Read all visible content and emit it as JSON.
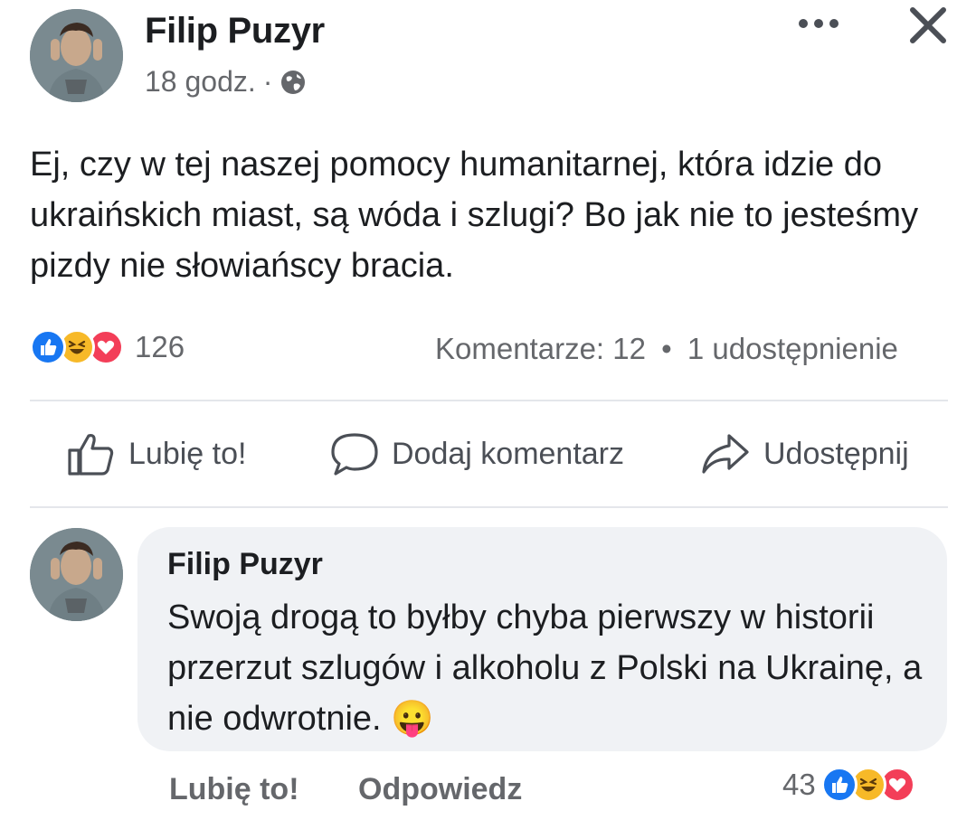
{
  "post": {
    "author": "Filip Puzyr",
    "time": "18 godz.",
    "separator": "·",
    "audience_icon": "globe-icon",
    "more_icon": "more-options-icon",
    "close_icon": "close-icon",
    "text": "Ej, czy w tej naszej pomocy humanitarnej, która idzie do ukraińskich miast, są wóda i szlugi? Bo jak nie to jesteśmy pizdy nie słowiańscy bracia."
  },
  "stats": {
    "reactions": [
      "like-reaction-icon",
      "haha-reaction-icon",
      "love-reaction-icon"
    ],
    "reaction_count": "126",
    "comments": "Komentarze: 12",
    "dot": "•",
    "shares": "1 udostępnienie"
  },
  "actions": {
    "like": "Lubię to!",
    "comment": "Dodaj komentarz",
    "share": "Udostępnij"
  },
  "comment": {
    "author": "Filip Puzyr",
    "text": "Swoją drogą to byłby chyba pierwszy w historii przerzut szlugów i alkoholu z Polski na Ukrainę, a nie odwrotnie.",
    "emoji": "😛",
    "like": "Lubię to!",
    "reply": "Odpowiedz",
    "reaction_count": "43",
    "reactions": [
      "like-reaction-icon",
      "haha-reaction-icon",
      "love-reaction-icon"
    ]
  },
  "colors": {
    "like_blue": "#1877f2",
    "haha_yellow": "#f7b928",
    "love_red": "#f33e58",
    "muted_text": "#65676b",
    "bubble_bg": "#f0f2f5"
  }
}
